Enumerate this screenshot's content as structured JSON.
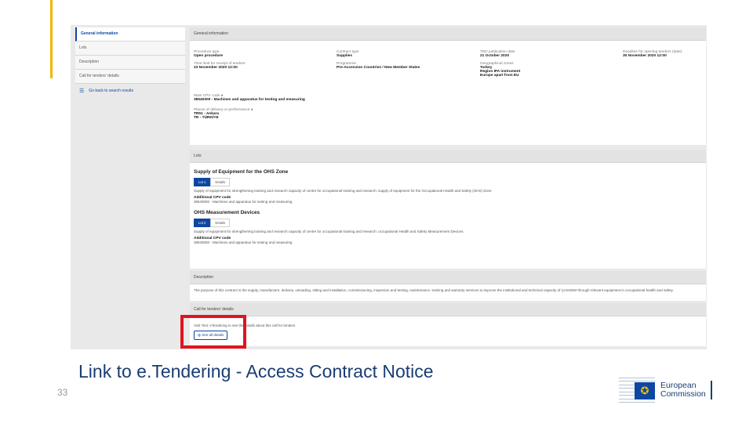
{
  "slide": {
    "title": "Link to e.Tendering - Access Contract Notice",
    "page_number": "33"
  },
  "logo": {
    "line1": "European",
    "line2": "Commission"
  },
  "colors": {
    "accent": "#f2b600",
    "highlight": "#e0141f",
    "title": "#1a3d73",
    "ec_blue": "#0e47a1"
  },
  "screenshot": {
    "sidenav": {
      "items": [
        {
          "label": "General information"
        },
        {
          "label": "Lots"
        },
        {
          "label": "Description"
        },
        {
          "label": "Call for tenders' details"
        }
      ],
      "back_label": "Go back to search results",
      "back_icon": "list-icon"
    },
    "general": {
      "header": "General information",
      "procedure_type_label": "Procedure type",
      "procedure_type": "Open procedure",
      "contract_type_label": "Contract type",
      "contract_type": "Supplies",
      "pub_date_label": "TED publication date",
      "pub_date": "21 October 2020",
      "deadline_opening_label": "Deadline for opening tenders (date)",
      "deadline_opening": "30 November 2020 12:00",
      "time_limit_label": "Time limit for receipt of tenders",
      "time_limit": "23 November 2020 12:00",
      "programme_label": "Programme",
      "programme": "Pre-Accession Countries / New Member States",
      "geo_zones_label": "Geographical zones",
      "geo_zones": [
        "Turkey",
        "Region IPA instrument",
        "Europe apart from EU"
      ],
      "cpv_label": "Main CPV code",
      "cpv": "38540000 - Machines and apparatus for testing and measuring",
      "places_label": "Places of delivery or performance",
      "places": [
        "TR51 - Ankara",
        "TR - TÜRKİYE"
      ]
    },
    "lots": {
      "header": "Lots",
      "items": [
        {
          "title": "Supply of Equipment for the OHS Zone",
          "tabs": [
            "Lot 1",
            "Details"
          ],
          "desc": "Supply of equipment for strengthening training and research capacity of centre for occupational training and research: supply of equipment for the Occupational Health and Safety (OHS) Zone.",
          "cpv_label": "Additional CPV code",
          "cpv": "38540000 - Machines and apparatus for testing and measuring"
        },
        {
          "title": "OHS Measurement Devices",
          "tabs": [
            "Lot 2",
            "Details"
          ],
          "desc": "Supply of equipment for strengthening training and research capacity of centre for occupational training and research: occupational Health and Safety Measurement Devices.",
          "cpv_label": "Additional CPV code",
          "cpv": "38540000 - Machines and apparatus for testing and measuring"
        }
      ]
    },
    "description": {
      "header": "Description",
      "text": "The purpose of this contract is the supply, manufacture, delivery, unloading, sitting and installation, commissioning, inspection and testing, maintenance, training and warranty services to improve the institutional and technical capacity of ÇASGEM through relevant equipment in occupational health and safety."
    },
    "call": {
      "header": "Call for tenders' details",
      "visit_text": "Visit Test: eTendering to see the details about this call for tenders",
      "button_label": "See all details",
      "button_icon": "globe-icon"
    }
  }
}
